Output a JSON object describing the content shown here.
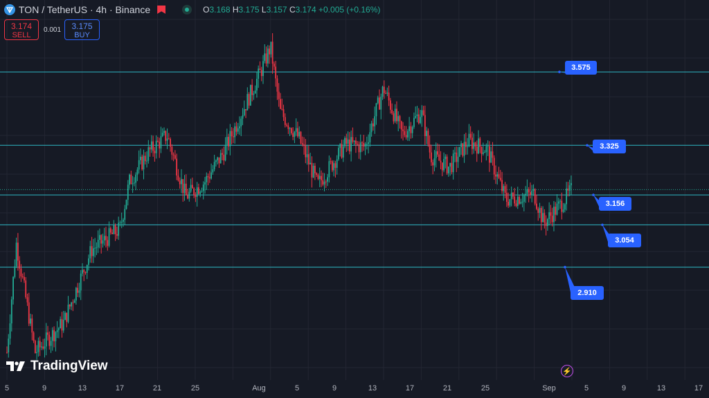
{
  "header": {
    "title": "TON / TetherUS · 4h · Binance",
    "open_label": "O",
    "open": "3.168",
    "high_label": "H",
    "high": "3.175",
    "low_label": "L",
    "low": "3.157",
    "close_label": "C",
    "close": "3.174",
    "change": "+0.005 (+0.16%)"
  },
  "trade": {
    "sell_price": "3.174",
    "sell_label": "SELL",
    "spread": "0.001",
    "buy_price": "3.175",
    "buy_label": "BUY"
  },
  "levels": [
    "3.575",
    "3.325",
    "3.156",
    "3.054",
    "2.910"
  ],
  "x_ticks": [
    "5",
    "9",
    "13",
    "17",
    "21",
    "25",
    "Aug",
    "5",
    "9",
    "13",
    "17",
    "21",
    "25",
    "Sep",
    "5",
    "9",
    "13",
    "17"
  ],
  "branding": {
    "logo_text": "TradingView"
  },
  "colors": {
    "background": "#161a25",
    "up": "#22ab94",
    "down": "#f23645",
    "level_line": "#2fb8c5",
    "callout": "#2962ff",
    "grid": "#232632"
  },
  "icons": {
    "symbol": "ton-icon",
    "flag": "flag-icon",
    "status": "live-dot-icon",
    "logo": "tradingview-logo-icon",
    "flash": "lightning-icon"
  },
  "chart_data": {
    "type": "candlestick",
    "title": "TON / TetherUS · 4h · Binance",
    "y_unit": "USDT",
    "ylim": [
      2.53,
      3.82
    ],
    "horizontal_levels": [
      3.575,
      3.325,
      3.156,
      3.054,
      2.91
    ],
    "last_price": 3.174,
    "grid": true,
    "close_path": [
      {
        "x": "Jul 5",
        "y": 2.62
      },
      {
        "x": "Jul 6",
        "y": 2.99
      },
      {
        "x": "Jul 8",
        "y": 2.62
      },
      {
        "x": "Jul 11",
        "y": 2.72
      },
      {
        "x": "Jul 14",
        "y": 2.97
      },
      {
        "x": "Jul 17",
        "y": 3.04
      },
      {
        "x": "Jul 18",
        "y": 3.2
      },
      {
        "x": "Jul 20",
        "y": 3.3
      },
      {
        "x": "Jul 22",
        "y": 3.36
      },
      {
        "x": "Jul 24",
        "y": 3.15
      },
      {
        "x": "Jul 26",
        "y": 3.2
      },
      {
        "x": "Jul 28",
        "y": 3.3
      },
      {
        "x": "Jul 30",
        "y": 3.44
      },
      {
        "x": "Aug 1",
        "y": 3.58
      },
      {
        "x": "Aug 2",
        "y": 3.66
      },
      {
        "x": "Aug 3",
        "y": 3.44
      },
      {
        "x": "Aug 5",
        "y": 3.35
      },
      {
        "x": "Aug 7",
        "y": 3.19
      },
      {
        "x": "Aug 10",
        "y": 3.33
      },
      {
        "x": "Aug 12",
        "y": 3.32
      },
      {
        "x": "Aug 14",
        "y": 3.52
      },
      {
        "x": "Aug 16",
        "y": 3.36
      },
      {
        "x": "Aug 18",
        "y": 3.44
      },
      {
        "x": "Aug 19",
        "y": 3.29
      },
      {
        "x": "Aug 21",
        "y": 3.25
      },
      {
        "x": "Aug 23",
        "y": 3.34
      },
      {
        "x": "Aug 25",
        "y": 3.31
      },
      {
        "x": "Aug 27",
        "y": 3.14
      },
      {
        "x": "Aug 30",
        "y": 3.16
      },
      {
        "x": "Aug 31",
        "y": 3.06
      },
      {
        "x": "Sep 2",
        "y": 3.13
      },
      {
        "x": "Sep 3",
        "y": 3.174
      }
    ]
  }
}
